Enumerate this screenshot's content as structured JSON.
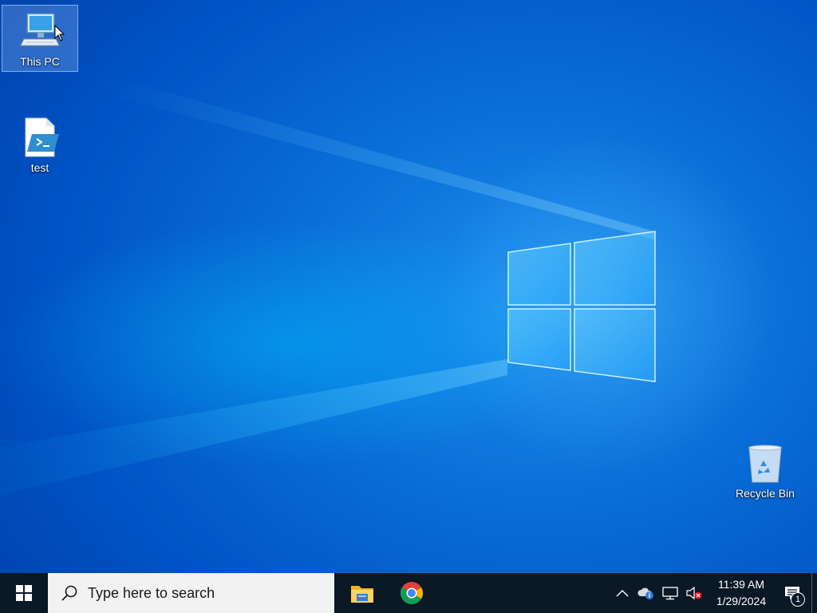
{
  "desktop": {
    "icons": [
      {
        "label": "This PC",
        "icon": "computer-icon",
        "selected": true
      },
      {
        "label": "test",
        "icon": "powershell-script-icon",
        "selected": false
      },
      {
        "label": "Recycle Bin",
        "icon": "recycle-bin-icon",
        "selected": false
      }
    ]
  },
  "taskbar": {
    "search_placeholder": "Type here to search",
    "pinned": [
      {
        "name": "File Explorer",
        "icon": "file-explorer-icon"
      },
      {
        "name": "Google Chrome",
        "icon": "chrome-icon"
      }
    ],
    "tray": {
      "time": "11:39 AM",
      "date": "1/29/2024",
      "notification_count": "1"
    }
  },
  "colors": {
    "taskbar": "#0b1826",
    "search_box": "#f2f2f2",
    "desktop_accent": "#0a6fd8"
  }
}
